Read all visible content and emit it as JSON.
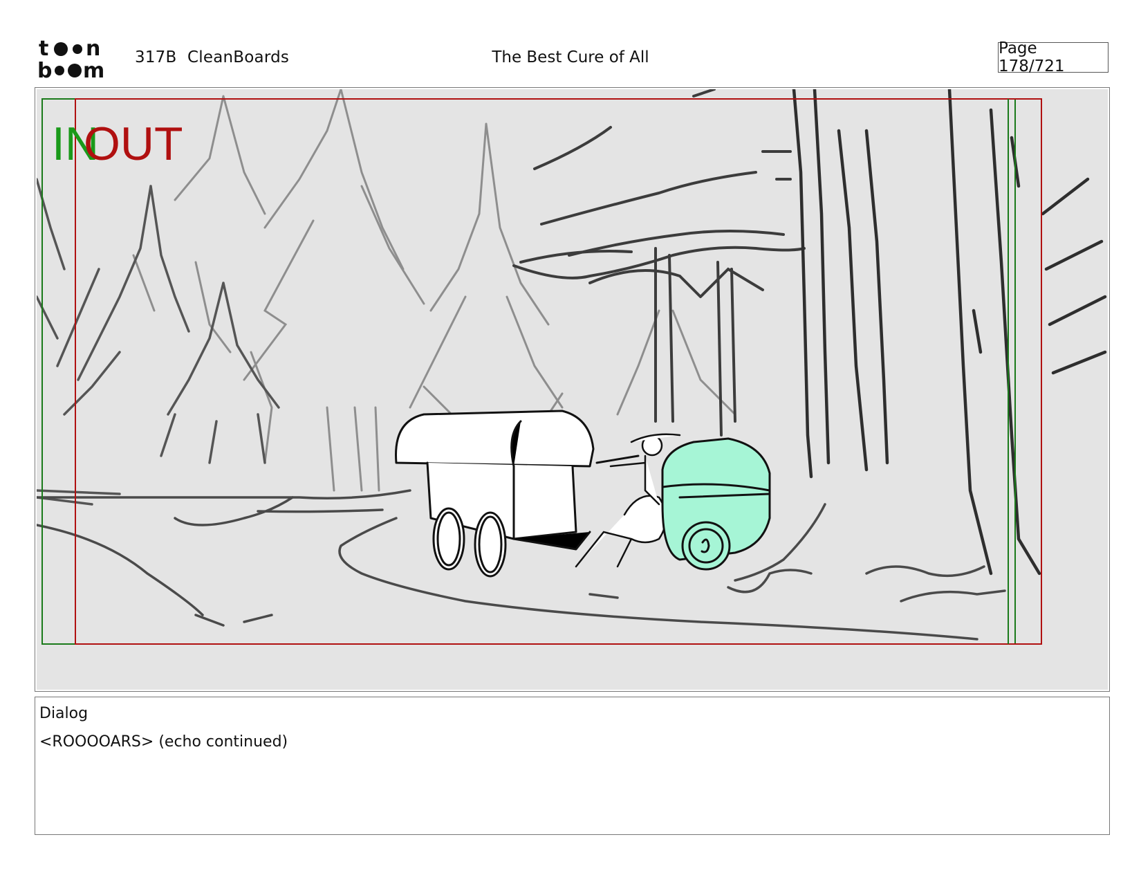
{
  "header": {
    "logo_text_top": "toon",
    "logo_text_bottom": "boom",
    "episode": "317B",
    "board_type": "CleanBoards",
    "title": "The Best Cure of All",
    "page": "Page 178/721"
  },
  "panel": {
    "in_marker": "IN",
    "out_marker": "OUT",
    "colors": {
      "background": "#e4e4e4",
      "in_color": "#1a9a1a",
      "out_color": "#b01010",
      "highlight": "#a6f5d6",
      "sketch_light": "#8e8e8e",
      "sketch_dark": "#2e2e2e"
    }
  },
  "dialog": {
    "label": "Dialog",
    "text": "<ROOOOARS> (echo continued)"
  }
}
